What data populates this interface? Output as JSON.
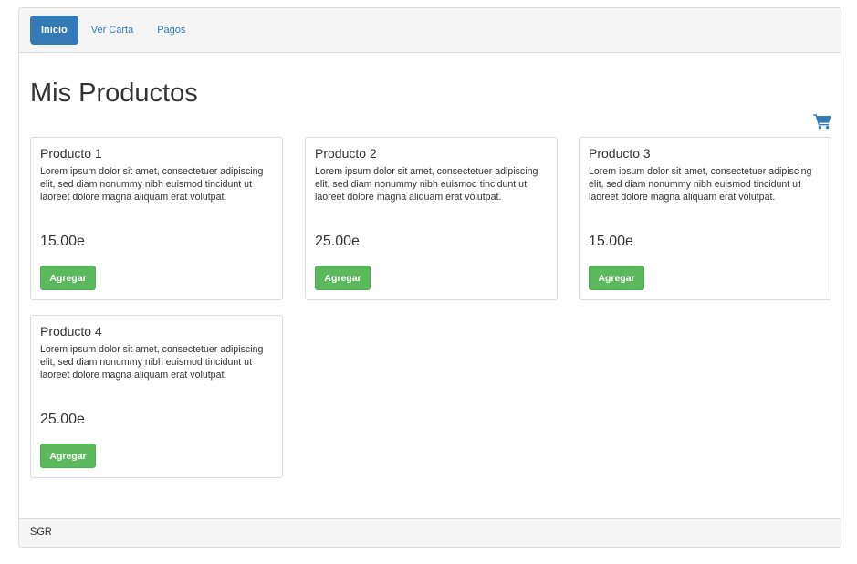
{
  "nav": {
    "items": [
      {
        "label": "Inicio",
        "active": true
      },
      {
        "label": "Ver Carta",
        "active": false
      },
      {
        "label": "Pagos",
        "active": false
      }
    ]
  },
  "main": {
    "title": "Mis Productos",
    "cart_icon": "shopping-cart-icon",
    "products": [
      {
        "name": "Producto 1",
        "description": "Lorem ipsum dolor sit amet, consectetuer adipiscing elit, sed diam nonummy nibh euismod tincidunt ut laoreet dolore magna aliquam erat volutpat.",
        "price": "15.00e",
        "button_label": "Agregar"
      },
      {
        "name": "Producto 2",
        "description": "Lorem ipsum dolor sit amet, consectetuer adipiscing elit, sed diam nonummy nibh euismod tincidunt ut laoreet dolore magna aliquam erat volutpat.",
        "price": "25.00e",
        "button_label": "Agregar"
      },
      {
        "name": "Producto 3",
        "description": "Lorem ipsum dolor sit amet, consectetuer adipiscing elit, sed diam nonummy nibh euismod tincidunt ut laoreet dolore magna aliquam erat volutpat.",
        "price": "15.00e",
        "button_label": "Agregar"
      },
      {
        "name": "Producto 4",
        "description": "Lorem ipsum dolor sit amet, consectetuer adipiscing elit, sed diam nonummy nibh euismod tincidunt ut laoreet dolore magna aliquam erat volutpat.",
        "price": "25.00e",
        "button_label": "Agregar"
      }
    ]
  },
  "footer": {
    "text": "SGR"
  },
  "colors": {
    "primary": "#337ab7",
    "success": "#5cb85c",
    "panel_bg": "#f5f5f5",
    "border": "#dddddd"
  }
}
